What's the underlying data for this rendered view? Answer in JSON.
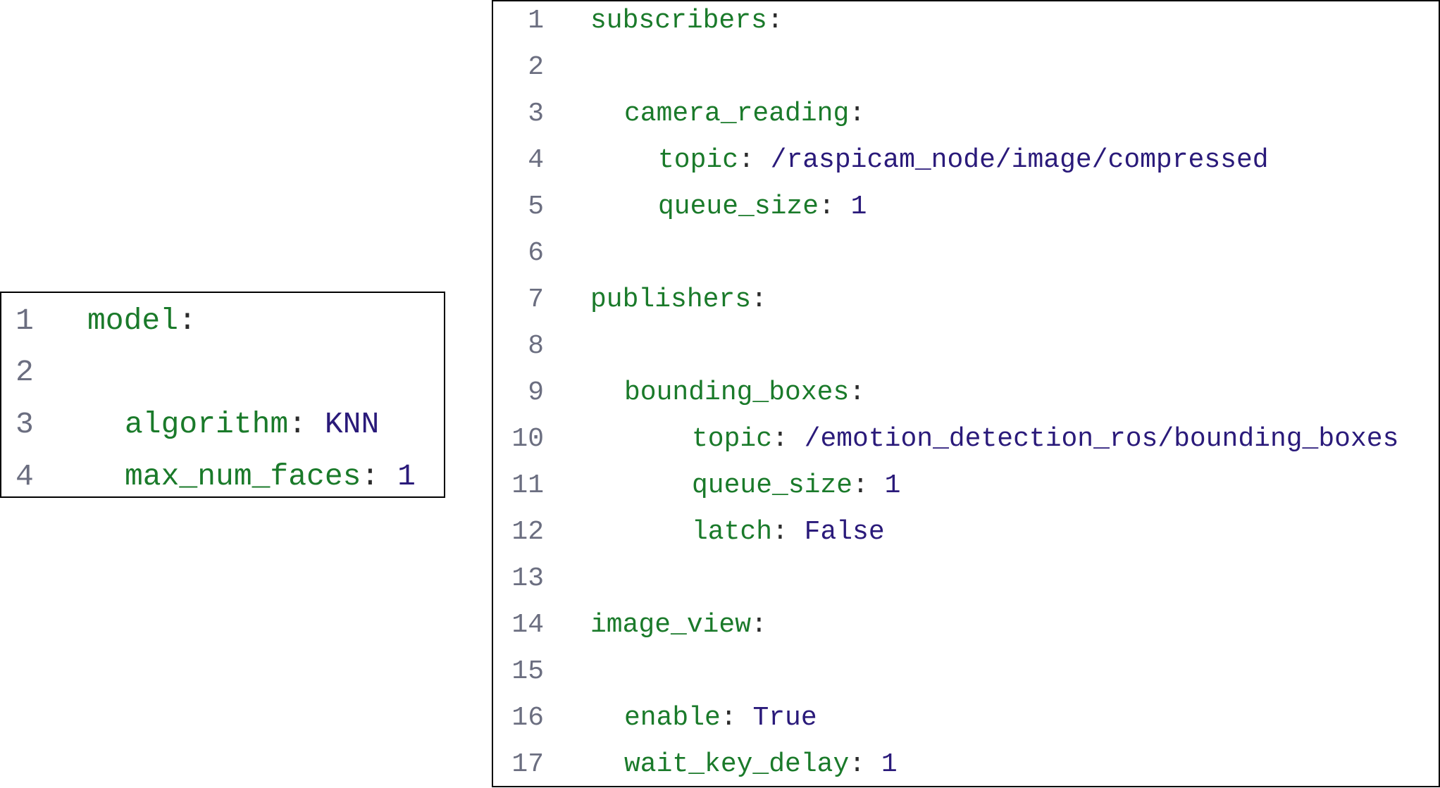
{
  "colors": {
    "key": "#1a7a2a",
    "value": "#2a1a7a",
    "line_number": "#6b6e80",
    "punctuation": "#2b2b2b",
    "border": "#000000"
  },
  "left_listing": {
    "lines": [
      {
        "num": "1",
        "key": "model",
        "sep": ":",
        "value": ""
      },
      {
        "num": "2",
        "key": "",
        "sep": "",
        "value": ""
      },
      {
        "num": "3",
        "key": "algorithm",
        "sep": ": ",
        "value": "KNN"
      },
      {
        "num": "4",
        "key": "max_num_faces",
        "sep": ": ",
        "value": "1"
      }
    ]
  },
  "right_listing": {
    "lines": [
      {
        "num": "1",
        "key": "subscribers",
        "sep": ":",
        "value": ""
      },
      {
        "num": "2",
        "key": "",
        "sep": "",
        "value": ""
      },
      {
        "num": "3",
        "key": "camera_reading",
        "sep": ":",
        "value": ""
      },
      {
        "num": "4",
        "key": "topic",
        "sep": ": ",
        "value": "/raspicam_node/image/compressed"
      },
      {
        "num": "5",
        "key": "queue_size",
        "sep": ": ",
        "value": "1"
      },
      {
        "num": "6",
        "key": "",
        "sep": "",
        "value": ""
      },
      {
        "num": "7",
        "key": "publishers",
        "sep": ":",
        "value": ""
      },
      {
        "num": "8",
        "key": "",
        "sep": "",
        "value": ""
      },
      {
        "num": "9",
        "key": "bounding_boxes",
        "sep": ":",
        "value": ""
      },
      {
        "num": "10",
        "key": "topic",
        "sep": ": ",
        "value": "/emotion_detection_ros/bounding_boxes"
      },
      {
        "num": "11",
        "key": "queue_size",
        "sep": ": ",
        "value": "1"
      },
      {
        "num": "12",
        "key": "latch",
        "sep": ": ",
        "value": "False"
      },
      {
        "num": "13",
        "key": "",
        "sep": "",
        "value": ""
      },
      {
        "num": "14",
        "key": "image_view",
        "sep": ":",
        "value": ""
      },
      {
        "num": "15",
        "key": "",
        "sep": "",
        "value": ""
      },
      {
        "num": "16",
        "key": "enable",
        "sep": ": ",
        "value": "True"
      },
      {
        "num": "17",
        "key": "wait_key_delay",
        "sep": ": ",
        "value": "1"
      }
    ]
  }
}
